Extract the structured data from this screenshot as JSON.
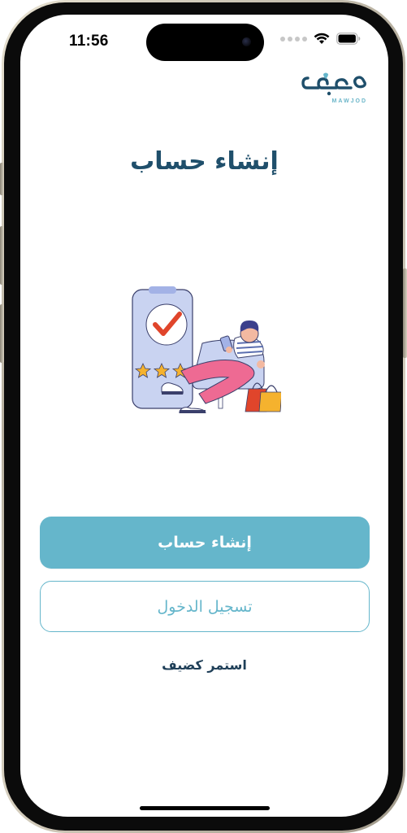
{
  "status_bar": {
    "time": "11:56"
  },
  "logo": {
    "text": "موجود",
    "subtext": "MAWJOD",
    "color": "#1f4f6b",
    "accent_color": "#65b6cb"
  },
  "page": {
    "title": "إنشاء حساب"
  },
  "buttons": {
    "create_account": "إنشاء حساب",
    "login": "تسجيل الدخول",
    "continue_as_guest": "استمر كضيف"
  },
  "colors": {
    "primary": "#65b6cb",
    "title": "#1f4f6b",
    "guest_text": "#1f3f58"
  },
  "icons": {
    "signal": "cellular-signal-icon",
    "wifi": "wifi-icon",
    "battery": "battery-icon",
    "illustration": "shopping-review-illustration"
  }
}
